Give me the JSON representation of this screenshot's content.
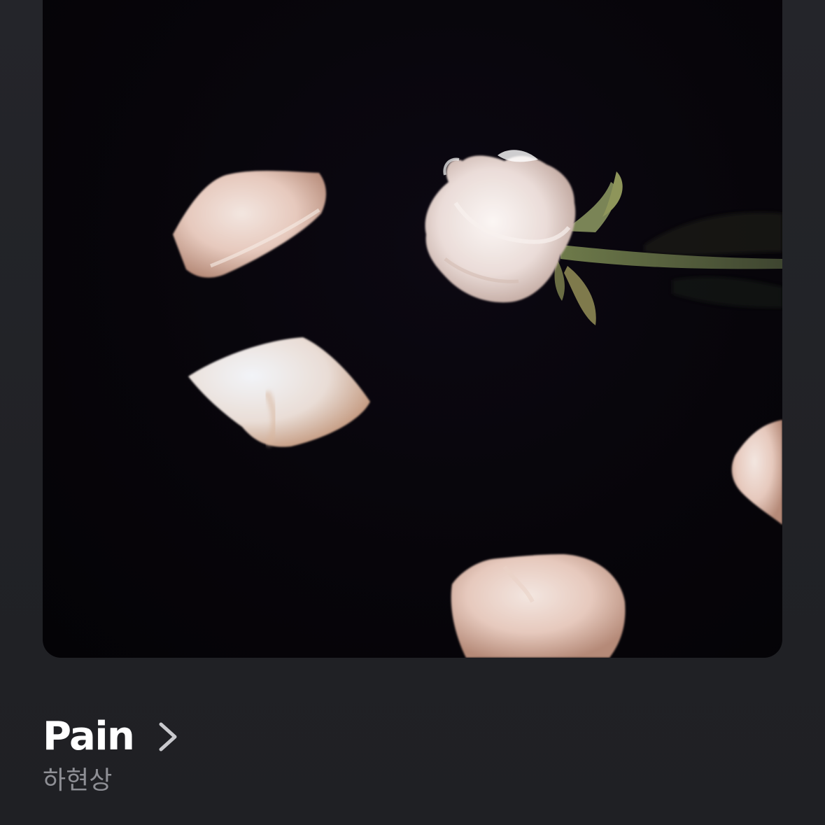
{
  "now_playing": {
    "title": "Pain",
    "artist": "하현상"
  },
  "icons": {
    "title_chevron": "chevron-right-icon"
  },
  "colors": {
    "background": "#222327",
    "title": "#ffffff",
    "artist": "#8e8f95",
    "chevron": "#c9c9cd",
    "artwork_background": "#07050a"
  }
}
